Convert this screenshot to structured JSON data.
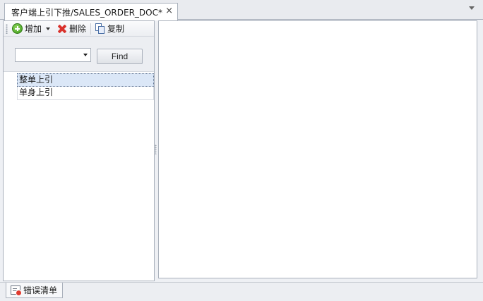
{
  "tab": {
    "title": "客户端上引下推/SALES_ORDER_DOC*",
    "close_icon": "×"
  },
  "toolbar": {
    "add_label": "增加",
    "delete_label": "删除",
    "copy_label": "复制"
  },
  "search": {
    "combo_value": "",
    "find_label": "Find"
  },
  "list": {
    "items": [
      {
        "label": "整单上引",
        "selected": true
      },
      {
        "label": "单身上引",
        "selected": false
      }
    ]
  },
  "bottom": {
    "tab_label": "错误清单"
  },
  "icons": {
    "add": "plus-circle-icon",
    "delete": "x-icon",
    "copy": "copy-icon",
    "error_list": "error-list-icon"
  },
  "colors": {
    "selection": "#dbe7f7",
    "delete_red": "#d9322c",
    "add_green": "#3e9a1c"
  }
}
